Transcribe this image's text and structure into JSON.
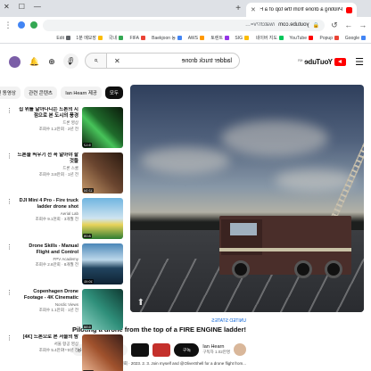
{
  "browser": {
    "tab_title": "Piloting a drone from the top of a FIRE ENGINE ladder! - YouTube",
    "url_domain": "youtube.com",
    "url_path": "/watch?v=…",
    "bookmarks": [
      {
        "label": "Google",
        "color": "#4285f4"
      },
      {
        "label": "Popup",
        "color": "#ea4335"
      },
      {
        "label": "YouTube",
        "color": "#ff0000"
      },
      {
        "label": "네이버 지도",
        "color": "#03c75a"
      },
      {
        "label": "SIG",
        "color": "#fbbc04"
      },
      {
        "label": "토렌트",
        "color": "#9334e6"
      },
      {
        "label": "AWS",
        "color": "#ff9900"
      },
      {
        "label": "Baekjoon 등",
        "color": "#4285f4"
      },
      {
        "label": "FIFA",
        "color": "#ea4335"
      },
      {
        "label": "국내",
        "color": "#34a853"
      },
      {
        "label": "1분 메모장",
        "color": "#fbbc04"
      },
      {
        "label": "Edit",
        "color": "#5f6368"
      }
    ]
  },
  "header": {
    "logo_text": "YouTube",
    "logo_country": "KR",
    "search_value": "ladder truck drone"
  },
  "video": {
    "hashtag": "UNITED STATES",
    "title": "Piloting a drone from the top of a FIRE ENGINE ladder!",
    "channel": "Ian Hearn",
    "subscribers": "구독자 1.02만명",
    "subscribe_label": "구독",
    "like_label": "519",
    "share_label": "공유",
    "description": "조회수 4.4천회 · 2023. 2. 3.  Join myself and @OliverShell for a drone flight from..."
  },
  "sidebar": {
    "chips": [
      {
        "label": "모두",
        "active": true
      },
      {
        "label": "Ian Hearn 제공",
        "active": false
      },
      {
        "label": "관련 콘텐츠",
        "active": false
      },
      {
        "label": "최근에 업로드된 동영상",
        "active": false
      }
    ],
    "recommendations": [
      {
        "title": "집 위를 날아다니는 드론의 시점으로 본 도시의 풍경",
        "channel": "드론 영상",
        "views": "조회수 1.2만회 · 2년 전",
        "duration": "5:12",
        "thumb": "linear-gradient(135deg,#0b1a0b,#1f6b2b 45%,#47c45a 60%,#0d200d)"
      },
      {
        "title": "드론을 띄우기 전 꼭 알아야 할 것들",
        "channel": "드론 스쿨",
        "views": "조회수 3.8만회 · 1년 전",
        "duration": "12:34",
        "thumb": "linear-gradient(135deg,#2a1a10,#6b4630 50%,#c79a6a)"
      },
      {
        "title": "DJI Mini 4 Pro - Fire truck ladder drone shot",
        "channel": "Aerial Lab",
        "views": "조회수 9.1천회 · 3개월 전",
        "duration": "8:05",
        "thumb": "linear-gradient(180deg,#6fb5e0 0%,#cfe4f0 50%,#e8d35a 65%,#2e7d32)"
      },
      {
        "title": "Drone Skills - Manual Flight and Control",
        "channel": "FPV Academy",
        "views": "조회수 2.6만회 · 8개월 전",
        "duration": "10:41",
        "thumb": "linear-gradient(180deg,#4b87b8 0%,#bcd7ea 40%,#21445f 60%,#0f2233)"
      },
      {
        "title": "Copenhagen Drone Footage - 4K Cinematic",
        "channel": "Nordic Views",
        "views": "조회수 1.1만회 · 1년 전",
        "duration": "6:58",
        "thumb": "linear-gradient(135deg,#0f3b33,#2f8f7a 50%,#8fd3c4)"
      },
      {
        "title": "[4K] 드론으로 본 서울의 밤",
        "channel": "서울 항공 영상",
        "views": "조회수 5.4만회 · 2년 전",
        "duration": "15:20",
        "thumb": "linear-gradient(135deg,#3a1f1a,#a0522d 50%,#f2c1a0)"
      }
    ]
  }
}
